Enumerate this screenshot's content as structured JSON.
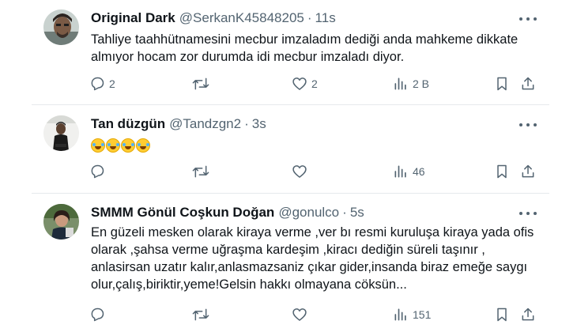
{
  "tweets": [
    {
      "name": "Original Dark",
      "handle": "@SerkanK45848205",
      "dot": "·",
      "time": "11s",
      "lines": [
        "Tahliye taahhütnamesini mecbur imzaladım dediği anda mahkeme dikkate",
        "almıyor hocam zor durumda idi mecbur imzaladı diyor."
      ],
      "reply_count": "2",
      "retweet_count": "",
      "like_count": "2",
      "view_count": "2 B"
    },
    {
      "name": "Tan düzgün",
      "handle": "@Tandzgn2",
      "dot": "·",
      "time": "3s",
      "emoji": "🤣🤣🤣🤣",
      "reply_count": "",
      "retweet_count": "",
      "like_count": "",
      "view_count": "46"
    },
    {
      "name": "SMMM Gönül Coşkun Doğan",
      "handle": "@gonulco",
      "dot": "·",
      "time": "5s",
      "lines": [
        "En güzeli mesken olarak kiraya verme ,ver bı resmi kuruluşa kiraya yada ofis",
        "olarak ,şahsa verme uğraşma kardeşim ,kiracı dediğin süreli taşınır ,",
        "anlasirsan uzatır kalır,anlasmazsaniz çıkar gider,insanda biraz emeğe saygı",
        "olur,çalış,biriktir,yeme!Gelsin hakkı olmayana cöksün..."
      ],
      "reply_count": "",
      "retweet_count": "",
      "like_count": "",
      "view_count": "151"
    }
  ],
  "icons": {
    "reply": "reply-icon",
    "retweet": "retweet-icon",
    "like": "like-icon",
    "views": "views-icon",
    "bookmark": "bookmark-icon",
    "share": "share-icon",
    "more": "more-icon"
  },
  "colors": {
    "text": "#0f1419",
    "muted": "#536471",
    "divider": "#e6e9ec"
  }
}
